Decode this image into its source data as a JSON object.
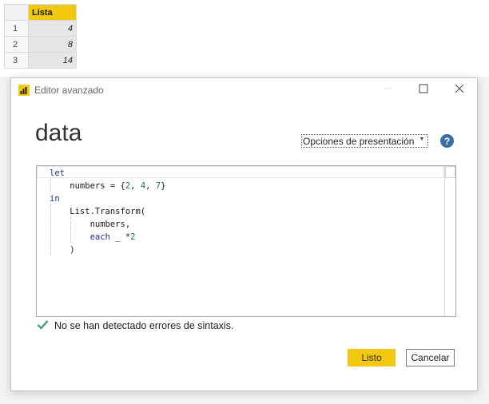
{
  "table": {
    "column_header": "Lista",
    "rows": [
      {
        "index": "1",
        "value": "4"
      },
      {
        "index": "2",
        "value": "8"
      },
      {
        "index": "3",
        "value": "14"
      }
    ]
  },
  "dialog": {
    "title": "Editor avanzado",
    "heading": "data",
    "options_label": "Opciones de presentación",
    "help_label": "?",
    "status_text": "No se han detectado errores de sintaxis.",
    "ok_label": "Listo",
    "cancel_label": "Cancelar"
  },
  "code": {
    "lines": [
      "let",
      "    numbers = {2, 4, 7}",
      "in",
      "    List.Transform(",
      "        numbers,",
      "        each _ *2",
      "    )"
    ]
  },
  "colors": {
    "accent": "#f2c811",
    "keyword": "#1d2f9e",
    "number": "#1a7a4a",
    "success": "#3a9a6e",
    "help": "#3a6ea8"
  },
  "icons": {
    "app": "powerbi-icon",
    "minimize": "minimize-icon",
    "maximize": "maximize-icon",
    "close": "close-icon",
    "help": "help-icon",
    "status": "checkmark-icon",
    "dropdown": "chevron-down-icon"
  }
}
